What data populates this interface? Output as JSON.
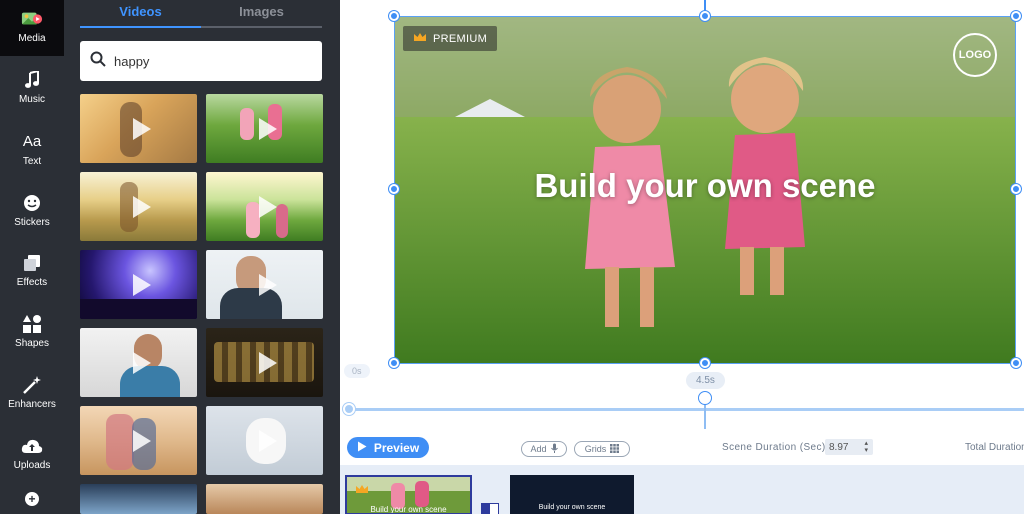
{
  "rail": {
    "items": [
      {
        "label": "Media",
        "icon": "media-icon"
      },
      {
        "label": "Music",
        "icon": "music-note-icon"
      },
      {
        "label": "Text",
        "icon": "text-aa-icon"
      },
      {
        "label": "Stickers",
        "icon": "sticker-icon"
      },
      {
        "label": "Effects",
        "icon": "effects-icon"
      },
      {
        "label": "Shapes",
        "icon": "shapes-icon"
      },
      {
        "label": "Enhancers",
        "icon": "magic-wand-icon"
      },
      {
        "label": "Uploads",
        "icon": "cloud-upload-icon"
      }
    ],
    "add_icon": "plus-icon"
  },
  "panel": {
    "tabs": [
      "Videos",
      "Images"
    ],
    "search": {
      "value": "happy",
      "icon": "search-icon"
    }
  },
  "canvas": {
    "premium_label": "PREMIUM",
    "logo_label": "LOGO",
    "title": "Build your own scene",
    "start_time": "0s",
    "end_time": "4.5s"
  },
  "controls": {
    "preview_label": "Preview",
    "add_label": "Add",
    "grids_label": "Grids",
    "scene_duration_label": "Scene Duration (Sec)",
    "scene_duration_value": "8.97",
    "total_duration_label": "Total Duration"
  },
  "scenes": [
    {
      "title": "Build your own scene"
    },
    {
      "title": "Build your own scene"
    }
  ],
  "colors": {
    "accent": "#3f8ef5",
    "rail_bg": "#0b0b0e",
    "panel_bg": "#2b2f36",
    "tab_active": "#3f94ff"
  }
}
